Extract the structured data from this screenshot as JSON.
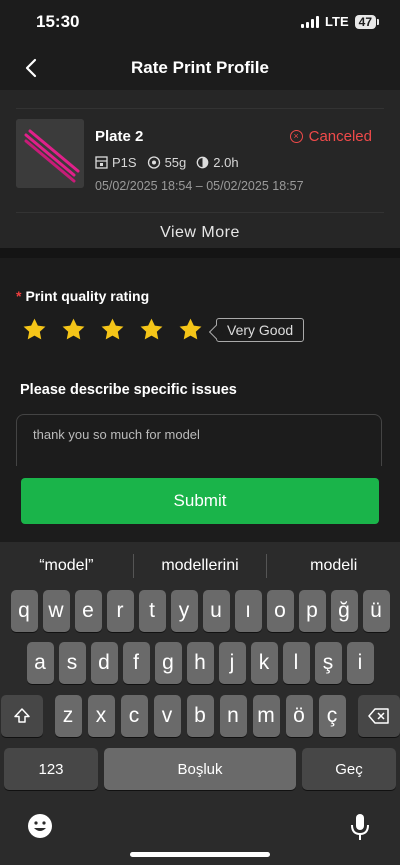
{
  "status": {
    "time": "15:30",
    "network": "LTE",
    "battery": "47"
  },
  "header": {
    "title": "Rate Print Profile"
  },
  "print": {
    "name": "Plate 2",
    "status": "Canceled",
    "printer": "P1S",
    "weight": "55g",
    "duration": "2.0h",
    "date_range": "05/02/2025 18:54 – 05/02/2025 18:57",
    "view_more": "View More"
  },
  "rating": {
    "required_mark": "*",
    "label": "Print quality rating",
    "stars": 5,
    "max_stars": 5,
    "badge": "Very Good"
  },
  "issues": {
    "label": "Please describe specific issues",
    "value": "thank you so much for model"
  },
  "submit_label": "Submit",
  "keyboard": {
    "suggestions": [
      "“model”",
      "modellerini",
      "modeli"
    ],
    "row1": [
      "q",
      "w",
      "e",
      "r",
      "t",
      "y",
      "u",
      "ı",
      "o",
      "p",
      "ğ",
      "ü"
    ],
    "row2": [
      "a",
      "s",
      "d",
      "f",
      "g",
      "h",
      "j",
      "k",
      "l",
      "ş",
      "i"
    ],
    "row3": [
      "z",
      "x",
      "c",
      "v",
      "b",
      "n",
      "m",
      "ö",
      "ç"
    ],
    "numbers_key": "123",
    "space_key": "Boşluk",
    "return_key": "Geç"
  },
  "colors": {
    "accent": "#1ab44a",
    "canceled": "#ef4a4a",
    "star": "#f5c518"
  }
}
